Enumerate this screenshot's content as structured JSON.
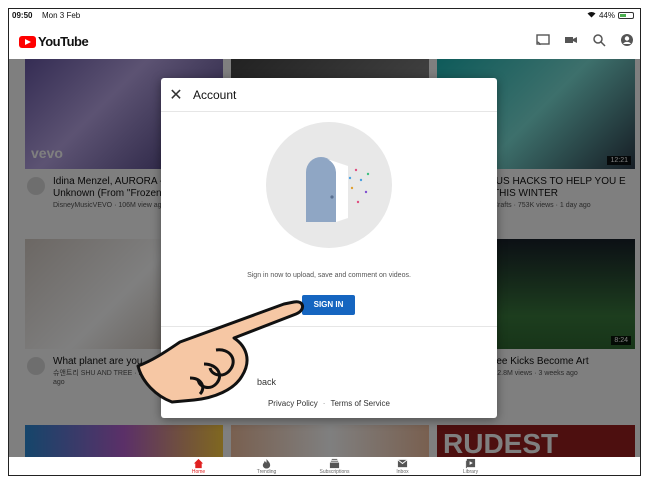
{
  "status": {
    "time": "09:50",
    "date": "Mon 3 Feb",
    "battery": "44%"
  },
  "header": {
    "brand": "YouTube"
  },
  "videos": [
    {
      "title": "Idina Menzel, AURORA - I Unknown (From \"Frozen",
      "meta": "DisneyMusicVEVO · 106M view ago",
      "badge": "vevo"
    },
    {
      "title": "IUS HACKS TO HELP YOU E THIS WINTER",
      "meta": "Crafts · 753K views · 1 day ago",
      "duration": "12:21"
    },
    {
      "title": "What planet are you",
      "meta": "슈앤트리 SHU AND TREE · months ago"
    },
    {
      "title": "ree Kicks Become Art",
      "meta": "· 2.8M views · 3 weeks ago",
      "duration": "8:24"
    },
    {
      "title": "RUDEST"
    }
  ],
  "dialog": {
    "title": "Account",
    "message": "Sign in now to upload, save and comment on videos.",
    "signin_label": "SIGN IN",
    "feedback": "back",
    "privacy": "Privacy Policy",
    "separator": "·",
    "terms": "Terms of Service"
  },
  "nav": [
    {
      "label": "Home",
      "icon": "home-icon"
    },
    {
      "label": "Trending",
      "icon": "flame-icon"
    },
    {
      "label": "Subscriptions",
      "icon": "subscriptions-icon"
    },
    {
      "label": "Inbox",
      "icon": "mail-icon"
    },
    {
      "label": "Library",
      "icon": "library-icon"
    }
  ],
  "colors": {
    "brand": "#ff0000",
    "signin": "#1565c0",
    "nav_active": "#e02020"
  }
}
